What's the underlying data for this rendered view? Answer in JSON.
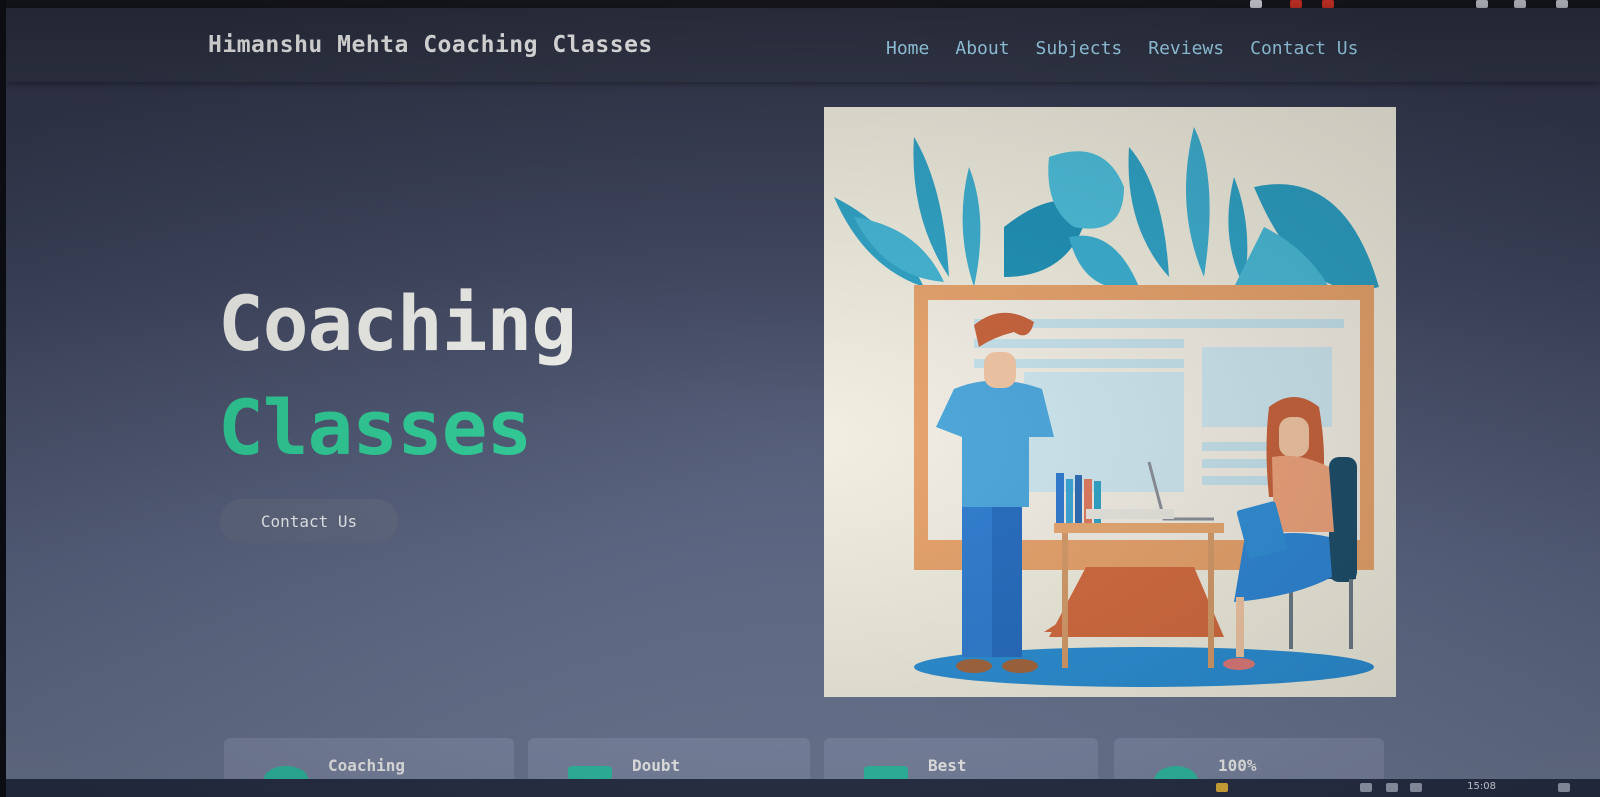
{
  "header": {
    "brand": "Himanshu Mehta Coaching Classes",
    "nav": [
      "Home",
      "About",
      "Subjects",
      "Reviews",
      "Contact Us"
    ]
  },
  "hero": {
    "title_line1": "Coaching",
    "title_line2": "Classes",
    "cta_label": "Contact Us"
  },
  "cards": [
    {
      "label": "Coaching",
      "icon": "graduation-cap-icon"
    },
    {
      "label": "Doubt",
      "icon": "mortarboard-icon"
    },
    {
      "label": "Best",
      "icon": "laptop-icon"
    },
    {
      "label": "100%",
      "icon": "badge-icon"
    }
  ],
  "taskbar": {
    "time": "15:08"
  },
  "colors": {
    "accent_green": "#2fd09a",
    "nav_link": "#9fd6f2",
    "header_bg": "#2b2f40",
    "illustration_bg": "#f1efe0"
  }
}
